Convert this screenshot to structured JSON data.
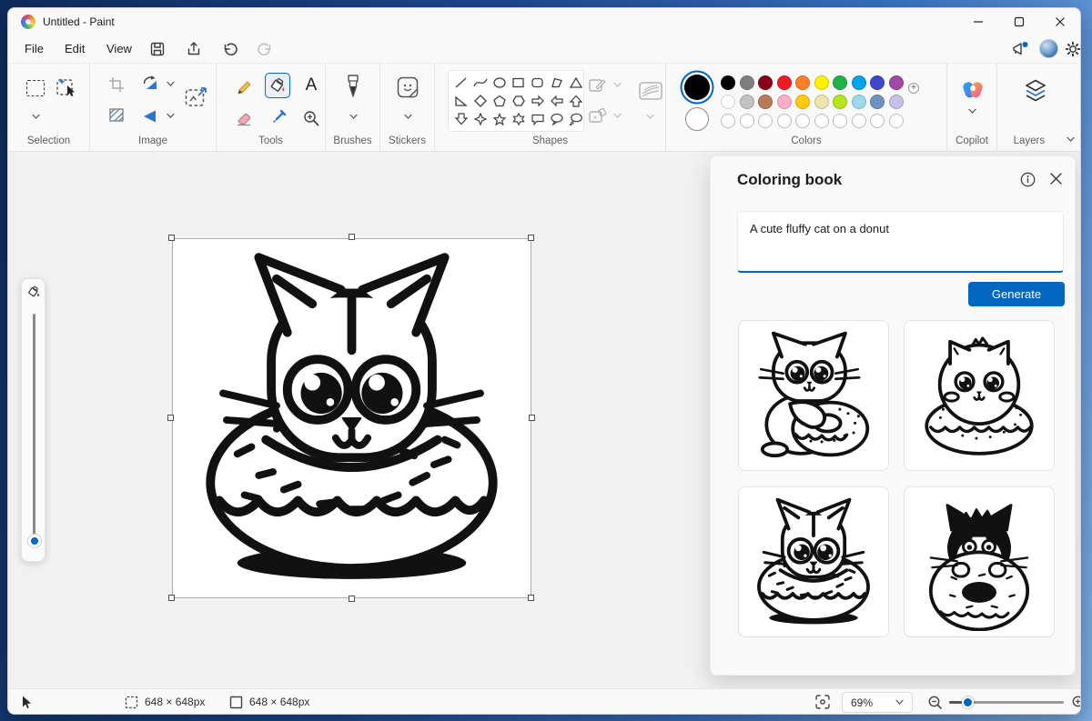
{
  "accent": "#0067C0",
  "window": {
    "title": "Untitled - Paint"
  },
  "menubar": {
    "items": [
      "File",
      "Edit",
      "View"
    ]
  },
  "ribbon": {
    "groups": {
      "selection": "Selection",
      "image": "Image",
      "tools": "Tools",
      "brushes": "Brushes",
      "stickers": "Stickers",
      "shapes": "Shapes",
      "colors": "Colors",
      "copilot": "Copilot",
      "layers": "Layers"
    },
    "tools": {
      "text_tool_glyph": "A"
    },
    "colors": {
      "color1": "#000000",
      "color2": "#FFFFFF",
      "row1": [
        "#000000",
        "#7F7F7F",
        "#880015",
        "#ED1C24",
        "#FF7F27",
        "#FFF200",
        "#22B14C",
        "#00A2E8",
        "#3F48CC",
        "#A349A4"
      ],
      "row2": [
        "#FFFFFF",
        "#C3C3C3",
        "#B97A57",
        "#FFAEC9",
        "#FFC90E",
        "#EFE4B0",
        "#B5E61D",
        "#99D9EA",
        "#7092BE",
        "#C8BFE7"
      ]
    }
  },
  "panel": {
    "title": "Coloring book",
    "prompt": "A cute fluffy cat on a donut",
    "generate_label": "Generate",
    "thumbnails": [
      {
        "alt": "Cat hugging a donut"
      },
      {
        "alt": "Round fluffy cat sitting on a donut"
      },
      {
        "alt": "Cat sitting inside a donut"
      },
      {
        "alt": "Black and white cat peeking over a donut"
      }
    ]
  },
  "canvas": {
    "alt": "Line art of a cute cat sitting in a sprinkled donut"
  },
  "statusbar": {
    "selection_size": "648 × 648px",
    "canvas_size": "648 × 648px",
    "zoom_value": "69%"
  }
}
